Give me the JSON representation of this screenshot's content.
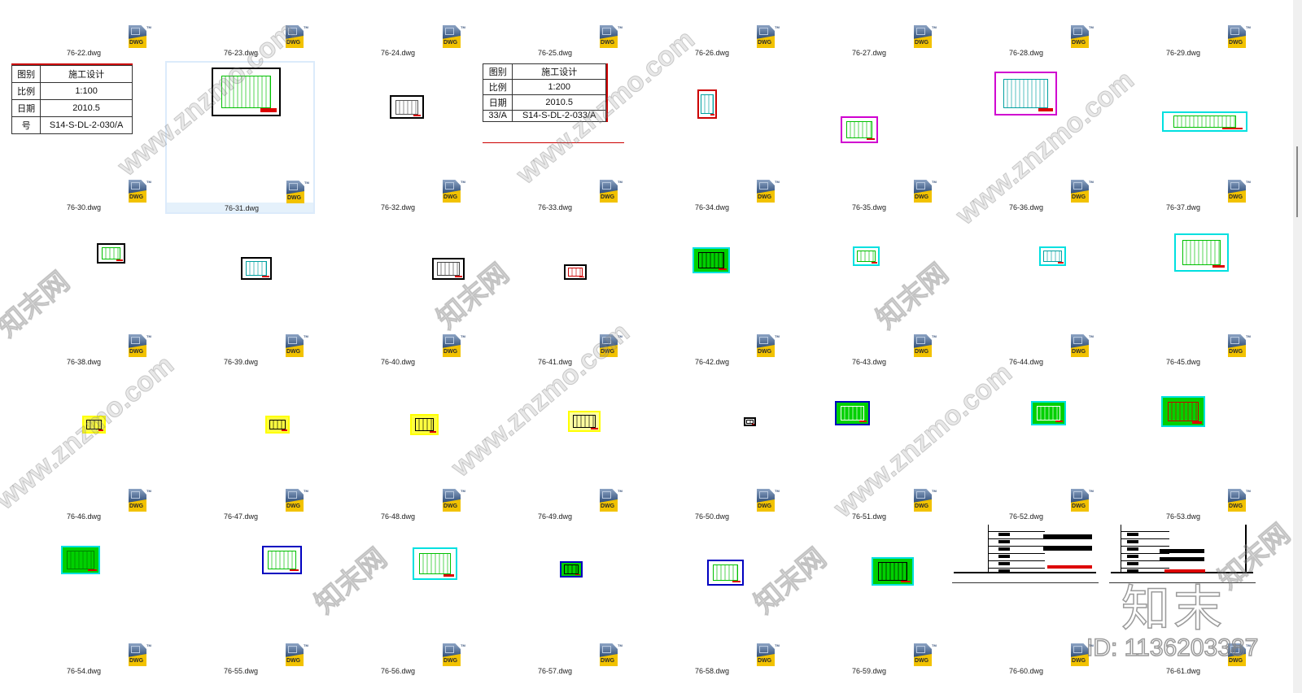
{
  "files": [
    {
      "name": "76-22.dwg"
    },
    {
      "name": "76-23.dwg"
    },
    {
      "name": "76-24.dwg"
    },
    {
      "name": "76-25.dwg"
    },
    {
      "name": "76-26.dwg"
    },
    {
      "name": "76-27.dwg"
    },
    {
      "name": "76-28.dwg"
    },
    {
      "name": "76-29.dwg"
    },
    {
      "name": "76-30.dwg",
      "preview": {
        "kind": "titleblock",
        "rows": [
          [
            "图别",
            "施工设计"
          ],
          [
            "比例",
            "1:100"
          ],
          [
            "日期",
            "2010.5"
          ],
          [
            "号",
            "S14-S-DL-2-030/A"
          ]
        ]
      }
    },
    {
      "name": "76-31.dwg",
      "selected": true,
      "preview": {
        "border": "#000000",
        "fill": "#ffffff",
        "accent": "#00c000"
      }
    },
    {
      "name": "76-32.dwg",
      "preview": {
        "border": "#000000",
        "fill": "#ffffff",
        "accent": "#555555"
      }
    },
    {
      "name": "76-33.dwg",
      "preview": {
        "kind": "titleblock",
        "rows": [
          [
            "图别",
            "施工设计"
          ],
          [
            "比例",
            "1:200"
          ],
          [
            "日期",
            "2010.5"
          ],
          [
            "33/A",
            "S14-S-DL-2-033/A"
          ]
        ]
      }
    },
    {
      "name": "76-34.dwg",
      "preview": {
        "border": "#cc0000",
        "fill": "#ffffff",
        "accent": "#00a0a0"
      }
    },
    {
      "name": "76-35.dwg",
      "preview": {
        "border": "#d000d0",
        "fill": "#ffffff",
        "accent": "#00c000"
      }
    },
    {
      "name": "76-36.dwg",
      "preview": {
        "border": "#d000d0",
        "fill": "#ffffff",
        "accent": "#00a0a0"
      }
    },
    {
      "name": "76-37.dwg",
      "preview": {
        "border": "#00e0e0",
        "fill": "#ffffff",
        "accent": "#00c000"
      }
    },
    {
      "name": "76-38.dwg",
      "preview": {
        "border": "#000000",
        "fill": "#ffffff",
        "accent": "#00c000"
      }
    },
    {
      "name": "76-39.dwg",
      "preview": {
        "border": "#000000",
        "fill": "#ffffff",
        "accent": "#00a0a0"
      }
    },
    {
      "name": "76-40.dwg",
      "preview": {
        "border": "#000000",
        "fill": "#ffffff",
        "accent": "#444444"
      }
    },
    {
      "name": "76-41.dwg",
      "preview": {
        "border": "#000000",
        "fill": "#ffffff",
        "accent": "#cc0000"
      }
    },
    {
      "name": "76-42.dwg",
      "preview": {
        "border": "#00e0e0",
        "fill": "#00d000",
        "accent": "#000000"
      }
    },
    {
      "name": "76-43.dwg",
      "preview": {
        "border": "#00e0e0",
        "fill": "#ffffff",
        "accent": "#00c000"
      }
    },
    {
      "name": "76-44.dwg",
      "preview": {
        "border": "#00e0e0",
        "fill": "#ffffff",
        "accent": "#00a0a0"
      }
    },
    {
      "name": "76-45.dwg",
      "preview": {
        "border": "#00e0e0",
        "fill": "#ffffff",
        "accent": "#00c000"
      }
    },
    {
      "name": "76-46.dwg",
      "preview": {
        "border": "#ffff00",
        "fill": "#ffff40",
        "accent": "#000000"
      }
    },
    {
      "name": "76-47.dwg",
      "preview": {
        "border": "#ffff00",
        "fill": "#ffff40",
        "accent": "#000000"
      }
    },
    {
      "name": "76-48.dwg",
      "preview": {
        "border": "#ffff00",
        "fill": "#ffff40",
        "accent": "#000000"
      }
    },
    {
      "name": "76-49.dwg",
      "preview": {
        "border": "#ffff00",
        "fill": "#ffffa0",
        "accent": "#000000"
      }
    },
    {
      "name": "76-50.dwg",
      "preview": {
        "border": "#000000",
        "fill": "#ffffff",
        "accent": "#000000"
      }
    },
    {
      "name": "76-51.dwg",
      "preview": {
        "border": "#0000c0",
        "fill": "#00d000",
        "accent": "#ffffff"
      }
    },
    {
      "name": "76-52.dwg",
      "preview": {
        "border": "#00e0e0",
        "fill": "#00d000",
        "accent": "#ffffff"
      }
    },
    {
      "name": "76-53.dwg",
      "preview": {
        "border": "#00e0e0",
        "fill": "#00d000",
        "accent": "#cc0000"
      }
    },
    {
      "name": "76-54.dwg",
      "preview": {
        "border": "#00e0e0",
        "fill": "#00d000",
        "accent": "#008000"
      }
    },
    {
      "name": "76-55.dwg",
      "preview": {
        "border": "#0000c0",
        "fill": "#ffffff",
        "accent": "#00c000"
      }
    },
    {
      "name": "76-56.dwg",
      "preview": {
        "border": "#00e0e0",
        "fill": "#ffffff",
        "accent": "#00c000"
      }
    },
    {
      "name": "76-57.dwg",
      "preview": {
        "border": "#0000c0",
        "fill": "#00d000",
        "accent": "#000000"
      }
    },
    {
      "name": "76-58.dwg",
      "preview": {
        "border": "#0000c0",
        "fill": "#ffffff",
        "accent": "#00c000"
      }
    },
    {
      "name": "76-59.dwg",
      "preview": {
        "border": "#00e0e0",
        "fill": "#00d000",
        "accent": "#000000"
      }
    },
    {
      "name": "76-60.dwg",
      "preview": {
        "kind": "stamp"
      }
    },
    {
      "name": "76-61.dwg",
      "preview": {
        "kind": "stamp2"
      }
    }
  ],
  "icon": {
    "name": "dwg-file-icon",
    "text": "DWG",
    "tm": "TM"
  },
  "watermark": {
    "url": "www.znzmo.com",
    "site": "知末网",
    "logo": "知末",
    "id": "ID: 1136203387"
  },
  "colors": {
    "selection_border": "#dcebfb",
    "selection_fill": "#e5f1fb"
  }
}
